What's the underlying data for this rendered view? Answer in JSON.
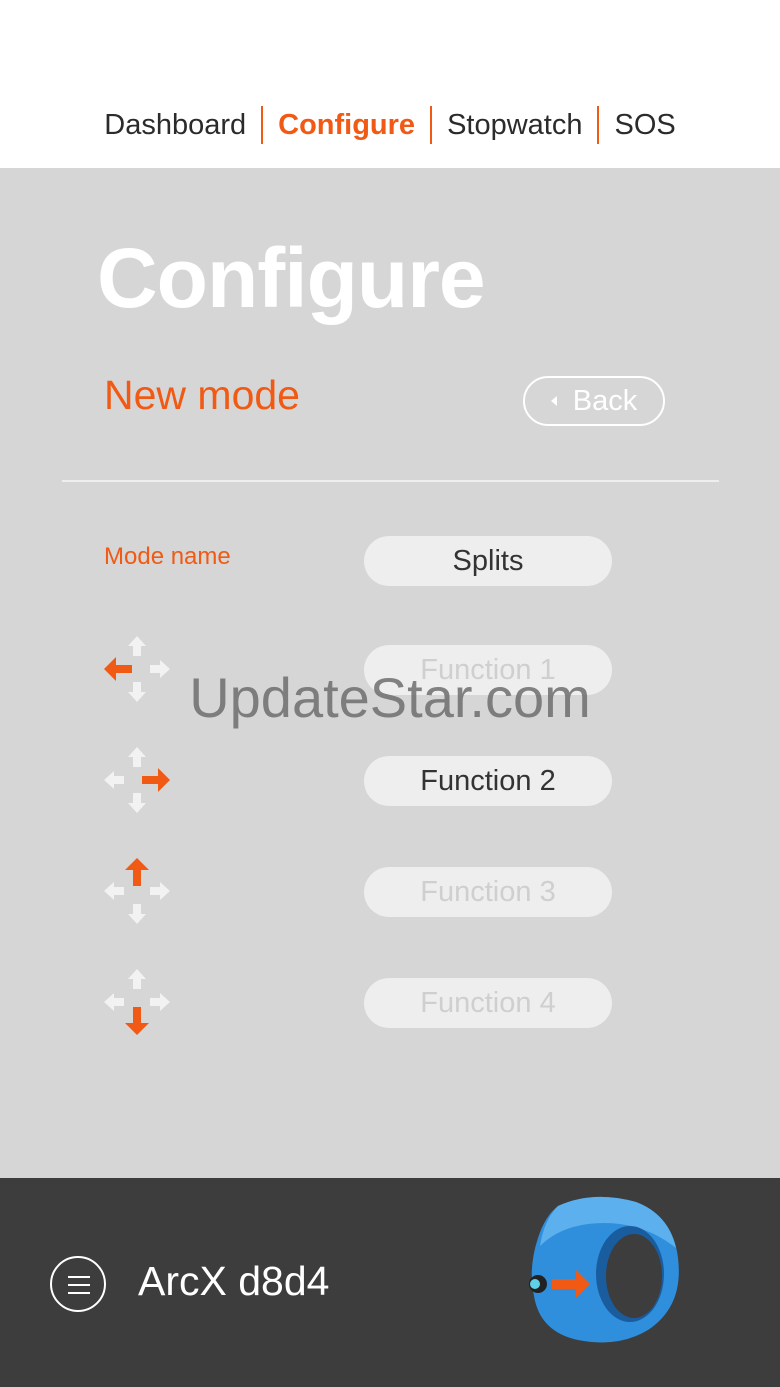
{
  "nav": {
    "tabs": [
      {
        "label": "Dashboard",
        "active": false
      },
      {
        "label": "Configure",
        "active": true
      },
      {
        "label": "Stopwatch",
        "active": false
      },
      {
        "label": "SOS",
        "active": false
      }
    ]
  },
  "page": {
    "title": "Configure",
    "subtitle": "New mode",
    "back_label": "Back"
  },
  "form": {
    "mode_name_label": "Mode name",
    "mode_name_value": "Splits",
    "functions": [
      {
        "direction": "left",
        "icon": "dpad-left-icon",
        "value": "",
        "placeholder": "Function 1"
      },
      {
        "direction": "right",
        "icon": "dpad-right-icon",
        "value": "Function 2",
        "placeholder": ""
      },
      {
        "direction": "up",
        "icon": "dpad-up-icon",
        "value": "",
        "placeholder": "Function 3"
      },
      {
        "direction": "down",
        "icon": "dpad-down-icon",
        "value": "",
        "placeholder": "Function 4"
      }
    ]
  },
  "watermark": "UpdateStar.com",
  "footer": {
    "device_name": "ArcX d8d4",
    "menu_icon": "hamburger-icon",
    "device_icon": "arcx-ring-icon"
  },
  "colors": {
    "accent": "#f05a14",
    "background": "#d6d6d6",
    "footer": "#3d3d3d",
    "ring": "#2f8fdc"
  }
}
